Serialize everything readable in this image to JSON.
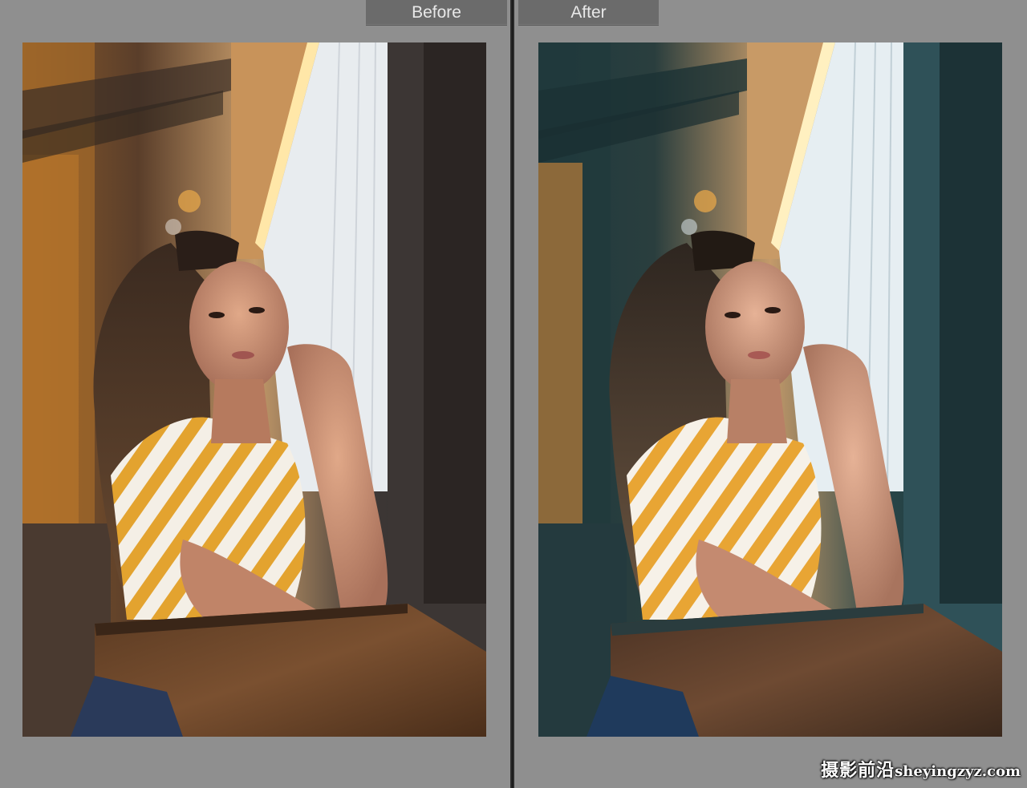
{
  "viewer": {
    "before_label": "Before",
    "after_label": "After",
    "watermark_cn": "摄影前沿",
    "watermark_en": "sheyingzyz.com"
  },
  "colors": {
    "background": "#8f8f8f",
    "tab": "#6b6b6b",
    "divider": "#2b2b2b",
    "before_wood": "#7a4e2a",
    "after_teal": "#2f5158",
    "shirt_yellow": "#e3a32f"
  }
}
